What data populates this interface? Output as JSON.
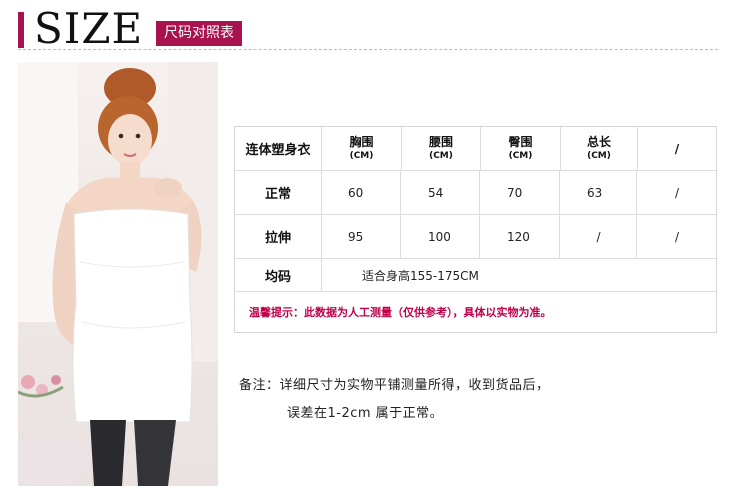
{
  "header": {
    "title": "SIZE",
    "badge": "尺码对照表"
  },
  "photo": {
    "description_icon": "model-photo"
  },
  "table": {
    "corner": "连体塑身衣",
    "columns": [
      {
        "label": "胸围",
        "unit": "(CM)"
      },
      {
        "label": "腰围",
        "unit": "(CM)"
      },
      {
        "label": "臀围",
        "unit": "(CM)"
      },
      {
        "label": "总长",
        "unit": "(CM)"
      },
      {
        "label": "/",
        "unit": ""
      }
    ],
    "rows": [
      {
        "label": "正常",
        "values": [
          "60",
          "54",
          "70",
          "63",
          "/"
        ]
      },
      {
        "label": "拉伸",
        "values": [
          "95",
          "100",
          "120",
          "/",
          "/"
        ]
      }
    ],
    "fit_row": {
      "label": "均码",
      "value": "适合身高155-175CM"
    },
    "tip": "温馨提示：此数据为人工测量（仅供参考），具体以实物为准。"
  },
  "note": {
    "line1": "备注：详细尺寸为实物平铺测量所得，收到货品后，",
    "line2": "误差在1-2cm 属于正常。"
  },
  "colors": {
    "accent": "#a8124f",
    "tip_text": "#c0004a"
  }
}
